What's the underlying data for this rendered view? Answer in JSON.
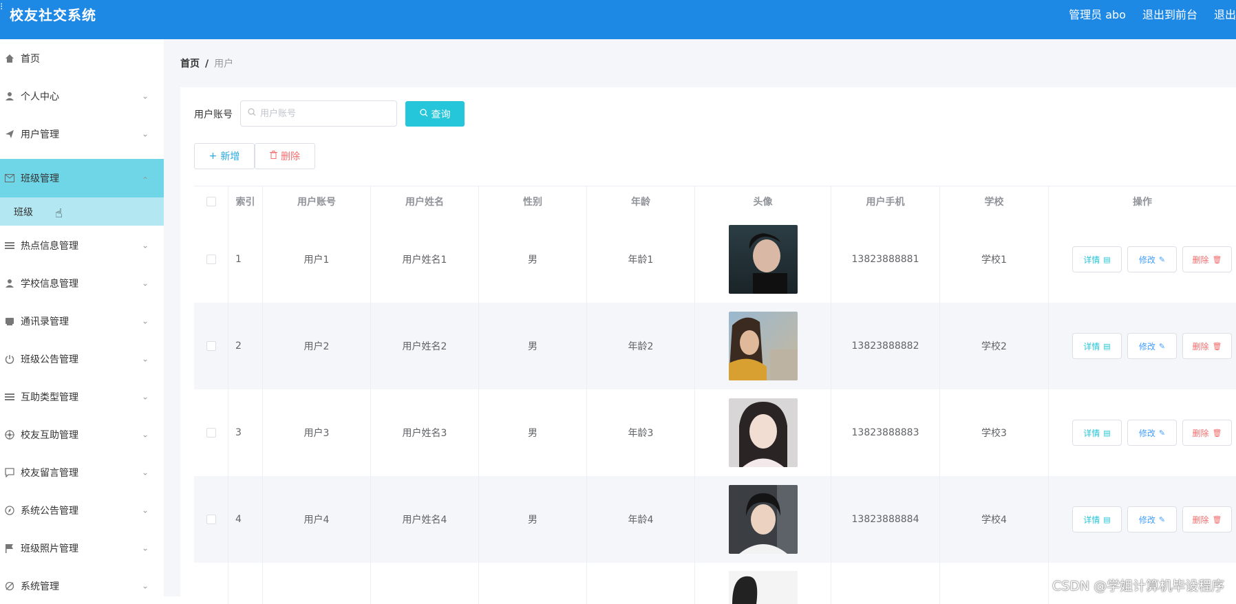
{
  "header": {
    "title": "校友社交系统",
    "admin": "管理员 abo",
    "to_front": "退出到前台",
    "logout": "退出"
  },
  "sidebar": {
    "items": [
      {
        "label": "首页",
        "icon": "home-icon"
      },
      {
        "label": "个人中心",
        "icon": "user-icon"
      },
      {
        "label": "用户管理",
        "icon": "send-icon"
      },
      {
        "label": "班级管理",
        "icon": "mail-icon"
      },
      {
        "label": "热点信息管理",
        "icon": "list-icon"
      },
      {
        "label": "学校信息管理",
        "icon": "user-icon"
      },
      {
        "label": "通讯录管理",
        "icon": "book-icon"
      },
      {
        "label": "班级公告管理",
        "icon": "power-icon"
      },
      {
        "label": "互助类型管理",
        "icon": "list-icon"
      },
      {
        "label": "校友互助管理",
        "icon": "target-icon"
      },
      {
        "label": "校友留言管理",
        "icon": "message-icon"
      },
      {
        "label": "系统公告管理",
        "icon": "compass-icon"
      },
      {
        "label": "班级照片管理",
        "icon": "flag-icon"
      },
      {
        "label": "系统管理",
        "icon": "settings-icon"
      }
    ],
    "submenu": {
      "label": "班级"
    }
  },
  "breadcrumb": {
    "home": "首页",
    "sep": "/",
    "current": "用户"
  },
  "search": {
    "label": "用户账号",
    "placeholder": "用户账号",
    "button": "查询"
  },
  "actions": {
    "add": "新增",
    "delete": "删除"
  },
  "table": {
    "headers": [
      "索引",
      "用户账号",
      "用户姓名",
      "性别",
      "年龄",
      "头像",
      "用户手机",
      "学校",
      "操作"
    ],
    "rows": [
      {
        "index": "1",
        "account": "用户1",
        "name": "用户姓名1",
        "gender": "男",
        "age": "年龄1",
        "phone": "13823888881",
        "school": "学校1"
      },
      {
        "index": "2",
        "account": "用户2",
        "name": "用户姓名2",
        "gender": "男",
        "age": "年龄2",
        "phone": "13823888882",
        "school": "学校2"
      },
      {
        "index": "3",
        "account": "用户3",
        "name": "用户姓名3",
        "gender": "男",
        "age": "年龄3",
        "phone": "13823888883",
        "school": "学校3"
      },
      {
        "index": "4",
        "account": "用户4",
        "name": "用户姓名4",
        "gender": "男",
        "age": "年龄4",
        "phone": "13823888884",
        "school": "学校4"
      }
    ],
    "op_labels": {
      "detail": "详情",
      "edit": "修改",
      "remove": "删除"
    }
  },
  "watermark": "CSDN @学姐计算机毕设程序",
  "colors": {
    "header": "#1e88e5",
    "active_menu": "#6fd6e8",
    "submenu": "#b3e7f1",
    "query": "#26c6da",
    "danger": "#f56c6c"
  }
}
